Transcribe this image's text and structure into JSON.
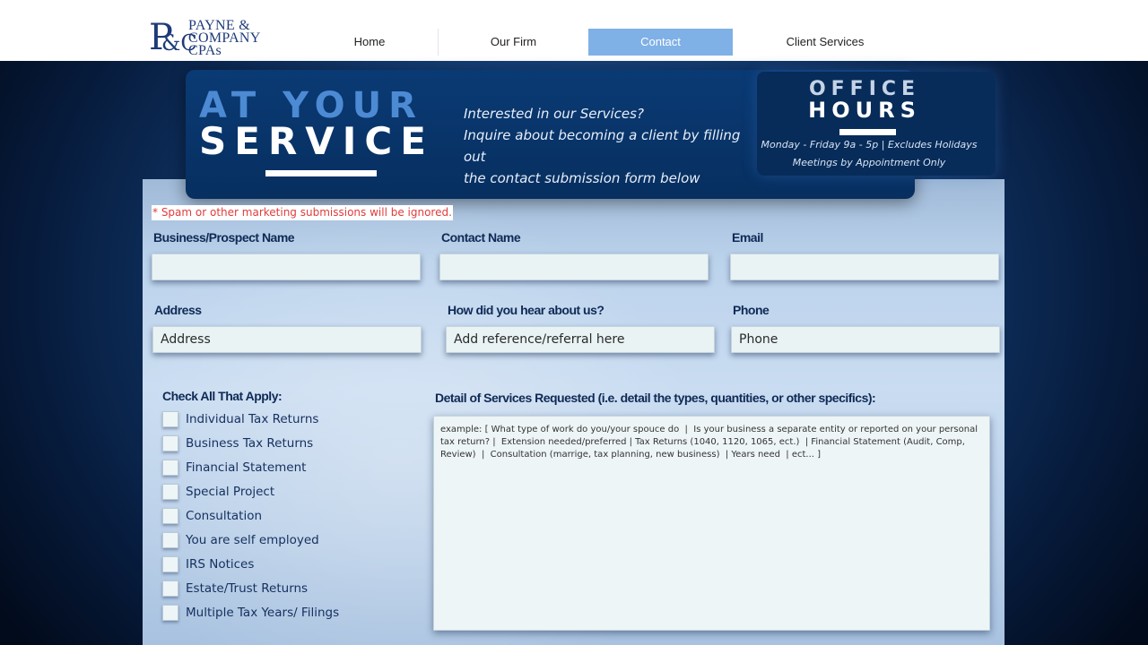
{
  "header": {
    "logo": {
      "mark": "P",
      "mark_amp": "&C",
      "line1": "PAYNE &",
      "line2": "COMPANY",
      "line3": "CPAs"
    },
    "nav": [
      {
        "label": "Home",
        "active": false
      },
      {
        "label": "Our Firm",
        "active": false
      },
      {
        "label": "Contact",
        "active": true
      },
      {
        "label": "Client Services",
        "active": false
      }
    ]
  },
  "hero": {
    "title_line1": "AT YOUR",
    "title_line2": "SERVICE",
    "copy_line1": "Interested in our Services?",
    "copy_line2": "Inquire about becoming a client by filling out",
    "copy_line3": "the contact submission form below",
    "office_title1": "OFFICE",
    "office_title2": "HOURS",
    "office_line1": "Monday - Friday 9a - 5p | Excludes Holidays",
    "office_line2": "Meetings by Appointment Only"
  },
  "form": {
    "spam_notice": "* Spam or other marketing submissions will be ignored.",
    "business_label": "Business/Prospect Name",
    "business_placeholder": "",
    "contact_label": "Contact Name",
    "contact_placeholder": "",
    "email_label": "Email",
    "email_placeholder": "",
    "address_label": "Address",
    "address_placeholder": "Address",
    "referral_label": "How did you hear about us?",
    "referral_placeholder": "Add reference/referral here",
    "phone_label": "Phone",
    "phone_placeholder": "Phone",
    "checks_label": "Check All That Apply:",
    "checks": [
      "Individual Tax Returns",
      "Business Tax Returns",
      "Financial Statement",
      "Special Project",
      "Consultation",
      "You are self employed",
      "IRS Notices",
      "Estate/Trust Returns",
      "Multiple Tax Years/ Filings"
    ],
    "detail_label": "Detail of Services Requested (i.e. detail the types, quantities, or other specifics):",
    "detail_placeholder": "example: [ What type of work do you/your spouce do  |  Is your business a separate entity or reported on your personal tax return? |  Extension needed/preferred | Tax Returns (1040, 1120, 1065, ect.)  | Financial Statement (Audit, Comp, Review)  |  Consultation (marrige, tax planning, new business)  | Years need  | ect... ]"
  }
}
